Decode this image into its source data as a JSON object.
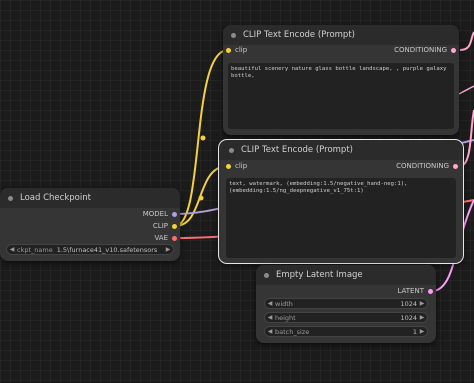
{
  "colors": {
    "clip": "#f2d13c",
    "conditioning": "#ffa7cf",
    "model": "#b39ddb",
    "vae": "#ff6e6e",
    "latent": "#ff9cf9"
  },
  "nodes": {
    "clip_top": {
      "title": "CLIP Text Encode (Prompt)",
      "input_label": "clip",
      "output_label": "CONDITIONING",
      "text": "beautiful scenery nature glass bottle landscape, , purple galaxy bottle,"
    },
    "clip_bottom": {
      "title": "CLIP Text Encode (Prompt)",
      "input_label": "clip",
      "output_label": "CONDITIONING",
      "text": "text, watermark, (embedding:1.5/negative_hand-neg:1),\n(embedding:1.5/ng_deepnegative_v1_75t:1)"
    },
    "checkpoint": {
      "title": "Load Checkpoint",
      "outputs": [
        "MODEL",
        "CLIP",
        "VAE"
      ],
      "ckpt_label": "ckpt_name",
      "ckpt_value": "1.5\\furnace41_v10.safetensors"
    },
    "latent": {
      "title": "Empty Latent Image",
      "output_label": "LATENT",
      "widgets": [
        {
          "label": "width",
          "value": "1024"
        },
        {
          "label": "height",
          "value": "1024"
        },
        {
          "label": "batch_size",
          "value": "1"
        }
      ]
    }
  },
  "icons": {
    "left": "triangle-left-icon",
    "right": "triangle-right-icon"
  }
}
